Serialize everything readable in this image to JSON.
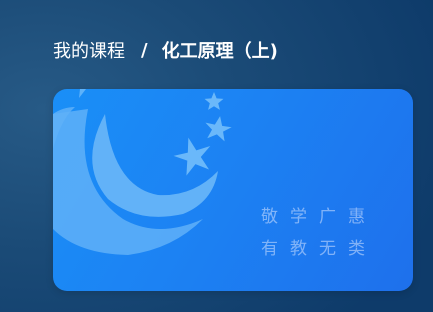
{
  "breadcrumb": {
    "parent": "我的课程",
    "separator": "/",
    "current": "化工原理（上)"
  },
  "course_card": {
    "logo": "school-emblem-icon",
    "motto_line1": "敬学广惠",
    "motto_line2": "有教无类"
  },
  "colors": {
    "page_background": "#1b4b77",
    "card_start": "#1a8ff7",
    "card_end": "#1e70ec",
    "logo_shape": "#5fb0f8",
    "motto_text": "#c6d8fb"
  }
}
